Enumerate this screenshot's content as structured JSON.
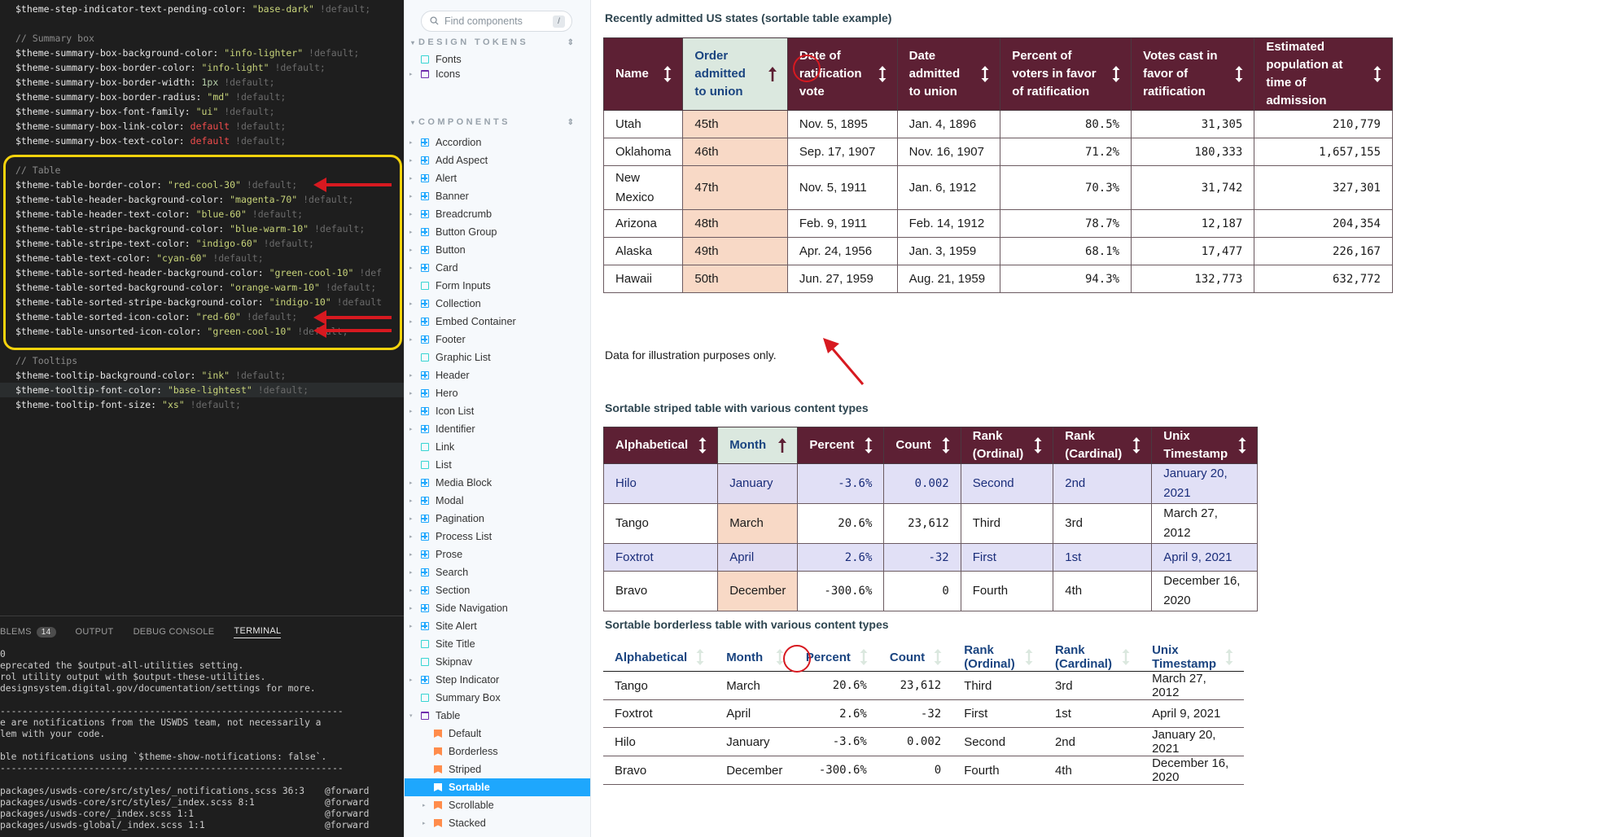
{
  "editor": {
    "lines": [
      {
        "parts": [
          [
            "v",
            "$theme-step-indicator-text-pending-color: "
          ],
          [
            "s",
            "\"base-dark\""
          ],
          [
            "d",
            " !default;"
          ]
        ]
      },
      {
        "parts": []
      },
      {
        "parts": [
          [
            "c",
            "// Summary box"
          ]
        ]
      },
      {
        "parts": [
          [
            "v",
            "$theme-summary-box-background-color: "
          ],
          [
            "s",
            "\"info-lighter\""
          ],
          [
            "d",
            " !default;"
          ]
        ]
      },
      {
        "parts": [
          [
            "v",
            "$theme-summary-box-border-color: "
          ],
          [
            "s",
            "\"info-light\""
          ],
          [
            "d",
            " !default;"
          ]
        ]
      },
      {
        "parts": [
          [
            "v",
            "$theme-summary-box-border-width: "
          ],
          [
            "n",
            "1px"
          ],
          [
            "d",
            " !default;"
          ]
        ]
      },
      {
        "parts": [
          [
            "v",
            "$theme-summary-box-border-radius: "
          ],
          [
            "s",
            "\"md\""
          ],
          [
            "d",
            " !default;"
          ]
        ]
      },
      {
        "parts": [
          [
            "v",
            "$theme-summary-box-font-family: "
          ],
          [
            "s",
            "\"ui\""
          ],
          [
            "d",
            " !default;"
          ]
        ]
      },
      {
        "parts": [
          [
            "v",
            "$theme-summary-box-link-color: "
          ],
          [
            "r",
            "default"
          ],
          [
            "d",
            " !default;"
          ]
        ]
      },
      {
        "parts": [
          [
            "v",
            "$theme-summary-box-text-color: "
          ],
          [
            "r",
            "default"
          ],
          [
            "d",
            " !default;"
          ]
        ]
      },
      {
        "parts": []
      },
      {
        "parts": [
          [
            "c",
            "// Table"
          ]
        ]
      },
      {
        "parts": [
          [
            "v",
            "$theme-table-border-color: "
          ],
          [
            "s",
            "\"red-cool-30\""
          ],
          [
            "d",
            " !default;"
          ]
        ]
      },
      {
        "parts": [
          [
            "v",
            "$theme-table-header-background-color: "
          ],
          [
            "s",
            "\"magenta-70\""
          ],
          [
            "d",
            " !default;"
          ]
        ]
      },
      {
        "parts": [
          [
            "v",
            "$theme-table-header-text-color: "
          ],
          [
            "s",
            "\"blue-60\""
          ],
          [
            "d",
            " !default;"
          ]
        ]
      },
      {
        "parts": [
          [
            "v",
            "$theme-table-stripe-background-color: "
          ],
          [
            "s",
            "\"blue-warm-10\""
          ],
          [
            "d",
            " !default;"
          ]
        ]
      },
      {
        "parts": [
          [
            "v",
            "$theme-table-stripe-text-color: "
          ],
          [
            "s",
            "\"indigo-60\""
          ],
          [
            "d",
            " !default;"
          ]
        ]
      },
      {
        "parts": [
          [
            "v",
            "$theme-table-text-color: "
          ],
          [
            "s",
            "\"cyan-60\""
          ],
          [
            "d",
            " !default;"
          ]
        ]
      },
      {
        "parts": [
          [
            "v",
            "$theme-table-sorted-header-background-color: "
          ],
          [
            "s",
            "\"green-cool-10\""
          ],
          [
            "d",
            " !def"
          ]
        ]
      },
      {
        "parts": [
          [
            "v",
            "$theme-table-sorted-background-color: "
          ],
          [
            "s",
            "\"orange-warm-10\""
          ],
          [
            "d",
            " !default;"
          ]
        ]
      },
      {
        "parts": [
          [
            "v",
            "$theme-table-sorted-stripe-background-color: "
          ],
          [
            "s",
            "\"indigo-10\""
          ],
          [
            "d",
            " !default"
          ]
        ]
      },
      {
        "parts": [
          [
            "v",
            "$theme-table-sorted-icon-color: "
          ],
          [
            "s",
            "\"red-60\""
          ],
          [
            "d",
            " !default;"
          ]
        ]
      },
      {
        "parts": [
          [
            "v",
            "$theme-table-unsorted-icon-color: "
          ],
          [
            "s",
            "\"green-cool-10\""
          ],
          [
            "d",
            " !default;"
          ]
        ]
      },
      {
        "parts": []
      },
      {
        "parts": [
          [
            "c",
            "// Tooltips"
          ]
        ]
      },
      {
        "parts": [
          [
            "v",
            "$theme-tooltip-background-color: "
          ],
          [
            "s",
            "\"ink\""
          ],
          [
            "d",
            " !default;"
          ]
        ]
      },
      {
        "parts": [
          [
            "v",
            "$theme-tooltip-font-color: "
          ],
          [
            "s",
            "\"base-lightest\""
          ],
          [
            "d",
            " !default;"
          ]
        ]
      },
      {
        "parts": [
          [
            "v",
            "$theme-tooltip-font-size: "
          ],
          [
            "s",
            "\"xs\""
          ],
          [
            "d",
            " !default;"
          ]
        ]
      }
    ]
  },
  "panel": {
    "tabs": [
      {
        "label": "BLEMS",
        "badge": "14"
      },
      {
        "label": "OUTPUT",
        "badge": ""
      },
      {
        "label": "DEBUG CONSOLE",
        "badge": ""
      },
      {
        "label": "TERMINAL",
        "badge": "",
        "active": true
      }
    ],
    "terminal_lines": [
      {
        "text": "0",
        "right": ""
      },
      {
        "text": "eprecated the $output-all-utilities setting.",
        "right": ""
      },
      {
        "text": "rol utility output with $output-these-utilities.",
        "right": ""
      },
      {
        "text": "designsystem.digital.gov/documentation/settings for more.",
        "right": ""
      },
      {
        "text": "",
        "right": ""
      },
      {
        "text": "--------------------------------------------------------------",
        "right": ""
      },
      {
        "text": "e are notifications from the USWDS team, not necessarily a",
        "right": ""
      },
      {
        "text": "lem with your code.",
        "right": ""
      },
      {
        "text": "",
        "right": ""
      },
      {
        "text": "ble notifications using `$theme-show-notifications: false`.",
        "right": ""
      },
      {
        "text": "--------------------------------------------------------------",
        "right": ""
      },
      {
        "text": "",
        "right": ""
      },
      {
        "text": "packages/uswds-core/src/styles/_notifications.scss 36:3",
        "right": "@forward"
      },
      {
        "text": "packages/uswds-core/src/styles/_index.scss 8:1",
        "right": "@forward"
      },
      {
        "text": "packages/uswds-core/_index.scss 1:1",
        "right": "@forward"
      },
      {
        "text": "packages/uswds-global/_index.scss 1:1",
        "right": "@forward"
      }
    ]
  },
  "sidebar": {
    "search_placeholder": "Find components",
    "search_shortcut": "/",
    "design_tokens_label": "DESIGN TOKENS",
    "components_label": "COMPONENTS",
    "design_tokens": [
      "Fonts",
      "Icons"
    ],
    "components": [
      "Accordion",
      "Add Aspect",
      "Alert",
      "Banner",
      "Breadcrumb",
      "Button Group",
      "Button",
      "Card",
      "Form Inputs",
      "Collection",
      "Embed Container",
      "Footer",
      "Graphic List",
      "Header",
      "Hero",
      "Icon List",
      "Identifier",
      "Link",
      "List",
      "Media Block",
      "Modal",
      "Pagination",
      "Process List",
      "Prose",
      "Search",
      "Section",
      "Side Navigation",
      "Site Alert",
      "Site Title",
      "Skipnav",
      "Step Indicator",
      "Summary Box",
      "Table"
    ],
    "table_children": [
      "Default",
      "Borderless",
      "Striped",
      "Sortable",
      "Scrollable",
      "Stacked"
    ]
  },
  "tables": {
    "t1": {
      "title": "Recently admitted US states (sortable table example)",
      "headers": [
        "Name",
        "Order admitted to union",
        "Date of ratification vote",
        "Date admitted to union",
        "Percent of voters in favor of ratification",
        "Votes cast in favor of ratification",
        "Estimated population at time of admission"
      ],
      "rows": [
        [
          "Utah",
          "45th",
          "Nov. 5, 1895",
          "Jan. 4, 1896",
          "80.5%",
          "31,305",
          "210,779"
        ],
        [
          "Oklahoma",
          "46th",
          "Sep. 17, 1907",
          "Nov. 16, 1907",
          "71.2%",
          "180,333",
          "1,657,155"
        ],
        [
          "New Mexico",
          "47th",
          "Nov. 5, 1911",
          "Jan. 6, 1912",
          "70.3%",
          "31,742",
          "327,301"
        ],
        [
          "Arizona",
          "48th",
          "Feb. 9, 1911",
          "Feb. 14, 1912",
          "78.7%",
          "12,187",
          "204,354"
        ],
        [
          "Alaska",
          "49th",
          "Apr. 24, 1956",
          "Jan. 3, 1959",
          "68.1%",
          "17,477",
          "226,167"
        ],
        [
          "Hawaii",
          "50th",
          "Jun. 27, 1959",
          "Aug. 21, 1959",
          "94.3%",
          "132,773",
          "632,772"
        ]
      ],
      "note": "Data for illustration purposes only."
    },
    "t2": {
      "title": "Sortable striped table with various content types",
      "headers": [
        "Alphabetical",
        "Month",
        "Percent",
        "Count",
        "Rank (Ordinal)",
        "Rank (Cardinal)",
        "Unix Timestamp"
      ],
      "rows": [
        [
          "Hilo",
          "January",
          "-3.6%",
          "0.002",
          "Second",
          "2nd",
          "January 20, 2021"
        ],
        [
          "Tango",
          "March",
          "20.6%",
          "23,612",
          "Third",
          "3rd",
          "March 27, 2012"
        ],
        [
          "Foxtrot",
          "April",
          "2.6%",
          "-32",
          "First",
          "1st",
          "April 9, 2021"
        ],
        [
          "Bravo",
          "December",
          "-300.6%",
          "0",
          "Fourth",
          "4th",
          "December 16, 2020"
        ]
      ]
    },
    "t3": {
      "title": "Sortable borderless table with various content types",
      "headers": [
        "Alphabetical",
        "Month",
        "Percent",
        "Count",
        "Rank (Ordinal)",
        "Rank (Cardinal)",
        "Unix Timestamp"
      ],
      "rows": [
        [
          "Tango",
          "March",
          "20.6%",
          "23,612",
          "Third",
          "3rd",
          "March 27, 2012"
        ],
        [
          "Foxtrot",
          "April",
          "2.6%",
          "-32",
          "First",
          "1st",
          "April 9, 2021"
        ],
        [
          "Hilo",
          "January",
          "-3.6%",
          "0.002",
          "Second",
          "2nd",
          "January 20, 2021"
        ],
        [
          "Bravo",
          "December",
          "-300.6%",
          "0",
          "Fourth",
          "4th",
          "December 16, 2020"
        ]
      ]
    }
  },
  "colors": {
    "header_bg": "#5d2034",
    "sorted_header_bg": "#dbe8df",
    "sorted_cell_bg": "#f8d9c6",
    "stripe_bg": "#e1e0f6",
    "annotation_red": "#d71920",
    "highlight_yellow": "#f5d30c"
  }
}
